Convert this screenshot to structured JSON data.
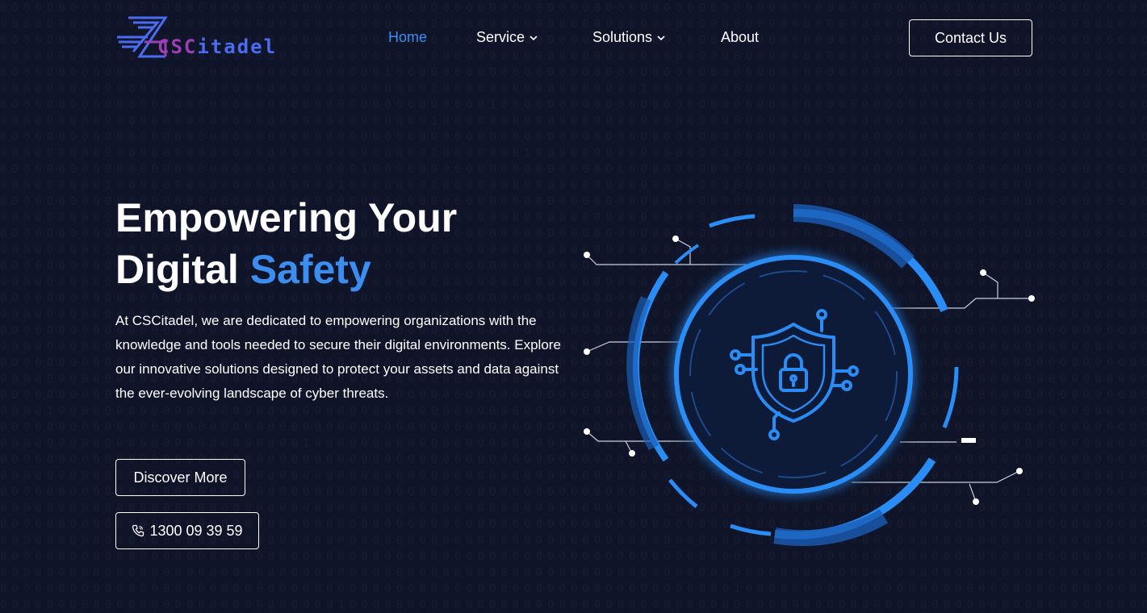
{
  "brand": {
    "name_cs": "CSC",
    "name_rest": "itadel",
    "accent_color": "#3b8ef0",
    "background_color": "#0f1428"
  },
  "nav": {
    "items": [
      {
        "label": "Home",
        "active": true
      },
      {
        "label": "Service",
        "has_dropdown": true
      },
      {
        "label": "Solutions",
        "has_dropdown": true
      },
      {
        "label": "About"
      }
    ],
    "contact_label": "Contact Us"
  },
  "hero": {
    "title_line1": "Empowering Your",
    "title_line2_plain": "Digital ",
    "title_line2_accent": "Safety",
    "description": "At CSCitadel, we are dedicated to empowering organizations with the knowledge and tools needed to secure their digital environments. Explore our innovative solutions designed to protect your assets and data against the ever-evolving landscape of cyber threats.",
    "discover_label": "Discover More",
    "phone_label": "1300 09 39 59",
    "phone_icon": "phone-icon"
  },
  "illustration": {
    "icon": "shield-lock-icon"
  }
}
